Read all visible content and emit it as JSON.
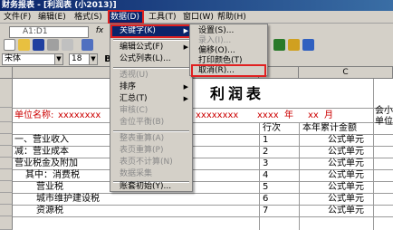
{
  "window": {
    "title": "财务报表 - [利润表 (小2013)]"
  },
  "menubar": {
    "items": [
      {
        "label": "文件(F)"
      },
      {
        "label": "编辑(E)"
      },
      {
        "label": "格式(S)"
      },
      {
        "label": "数据(D)"
      },
      {
        "label": "工具(T)"
      },
      {
        "label": "窗口(W)"
      },
      {
        "label": "帮助(H)"
      }
    ]
  },
  "formula_bar": {
    "cell_ref": "A1:D1",
    "fx": "fx"
  },
  "format_bar": {
    "font": "宋体",
    "size": "18",
    "bold": "B"
  },
  "data_menu": {
    "items": [
      {
        "label": "关键字(K)"
      },
      {
        "label": "编辑公式(F)"
      },
      {
        "label": "公式列表(L)..."
      },
      {
        "label": "透视(U)"
      },
      {
        "label": "排序"
      },
      {
        "label": "汇总(T)"
      },
      {
        "label": "审核(C)"
      },
      {
        "label": "舍位平衡(B)"
      },
      {
        "label": "整表重算(A)"
      },
      {
        "label": "表页重算(P)"
      },
      {
        "label": "表页不计算(N)"
      },
      {
        "label": "数据采集"
      },
      {
        "label": "账套初始(Y)..."
      }
    ]
  },
  "keyword_submenu": {
    "items": [
      {
        "label": "设置(S)..."
      },
      {
        "label": "录入(I)..."
      },
      {
        "label": "偏移(O)..."
      },
      {
        "label": "打印颜色(T)"
      },
      {
        "label": "取消(R)..."
      }
    ]
  },
  "sheet": {
    "col_c": "C",
    "title": "利润表",
    "company_label": "单位名称:",
    "company_placeholder": "xxxxxxxx",
    "keyword_placeholder": "xxxxxxxx",
    "date_year_placeholder": "xxxx",
    "year_suffix": "年",
    "date_month_placeholder": "xx",
    "month_suffix": "月",
    "right_note_1": "会小",
    "right_note_2": "单位",
    "col_item_suffix": "项",
    "col_seq": "行次",
    "col_amount": "本年累计金额",
    "rows": [
      {
        "label": "一、营业收入",
        "seq": "1",
        "value": "公式单元"
      },
      {
        "label": "减：营业成本",
        "seq": "2",
        "value": "公式单元"
      },
      {
        "label": "营业税金及附加",
        "seq": "3",
        "value": "公式单元"
      },
      {
        "label": "其中：消费税",
        "seq": "4",
        "value": "公式单元"
      },
      {
        "label": "营业税",
        "seq": "5",
        "value": "公式单元"
      },
      {
        "label": "城市维护建设税",
        "seq": "6",
        "value": "公式单元"
      },
      {
        "label": "资源税",
        "seq": "7",
        "value": "公式单元"
      }
    ]
  }
}
